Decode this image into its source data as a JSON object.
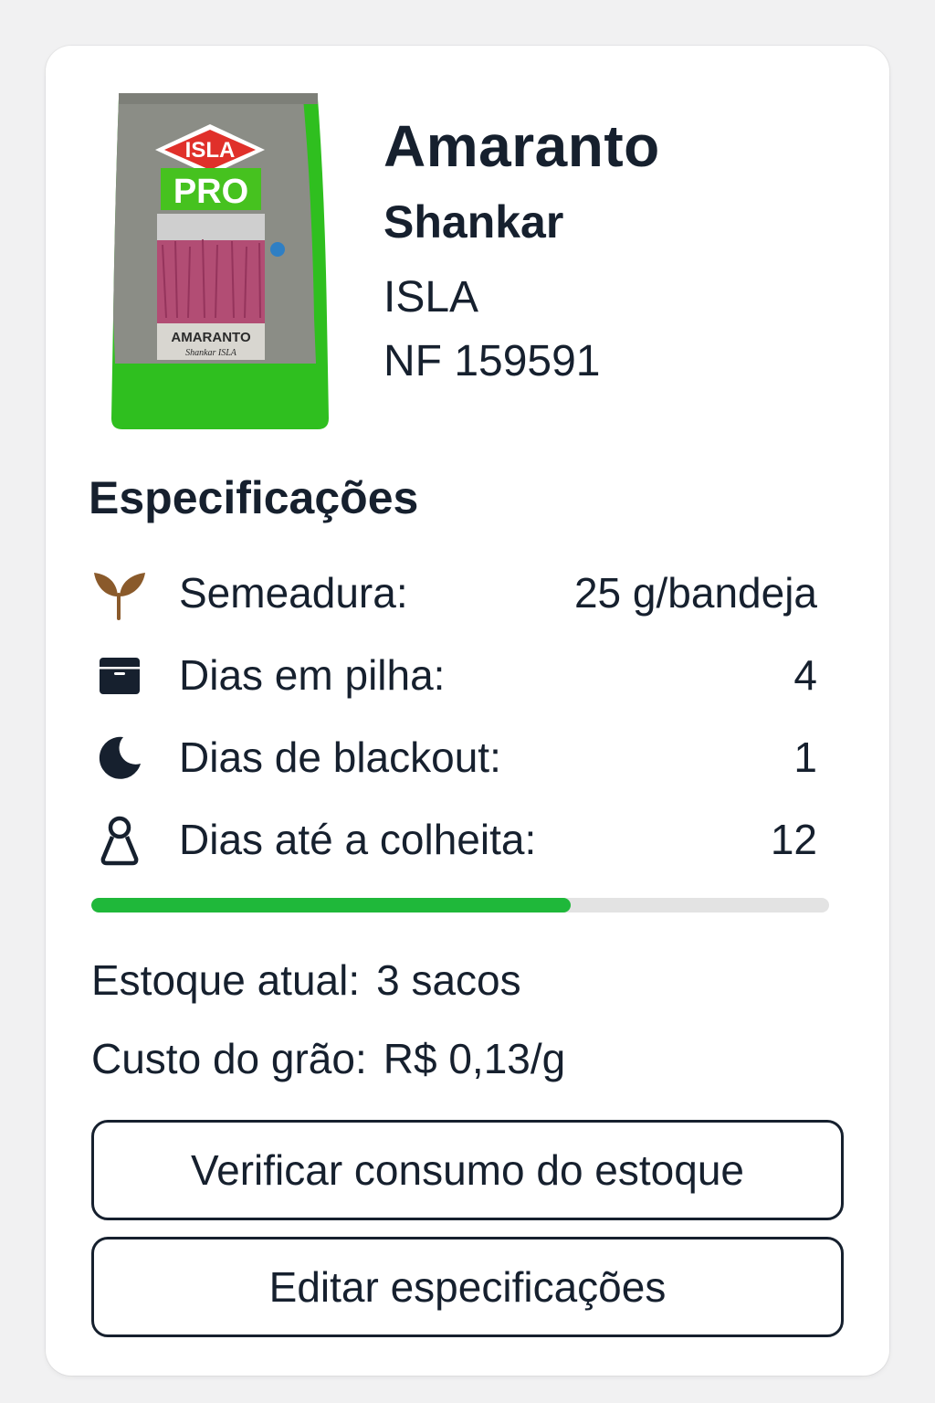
{
  "product": {
    "name": "Amaranto",
    "variety": "Shankar",
    "brand": "ISLA",
    "invoice": "NF 159591",
    "package_art": {
      "logo_text": "ISLA",
      "line_text": "PRO",
      "package_label": "AMARANTO",
      "package_sublabel": "Shankar ISLA"
    }
  },
  "specs": {
    "title": "Especificações",
    "rows": [
      {
        "icon": "sprout-icon",
        "label": "Semeadura:",
        "value": "25 g/bandeja"
      },
      {
        "icon": "box-icon",
        "label": "Dias em pilha:",
        "value": "4"
      },
      {
        "icon": "moon-icon",
        "label": "Dias de blackout:",
        "value": "1"
      },
      {
        "icon": "harvest-icon",
        "label": "Dias até a colheita:",
        "value": "12"
      }
    ]
  },
  "progress": {
    "fraction": 0.65,
    "color": "#1fb83a"
  },
  "stock": {
    "label": "Estoque atual:",
    "value": "3 sacos"
  },
  "cost": {
    "label": "Custo do grão:",
    "value": "R$ 0,13/g"
  },
  "actions": {
    "check_stock": "Verificar consumo do estoque",
    "edit_specs": "Editar especificações"
  },
  "colors": {
    "text": "#16202e",
    "accent_green": "#1fb83a",
    "icon_brown": "#8a5a2b"
  }
}
